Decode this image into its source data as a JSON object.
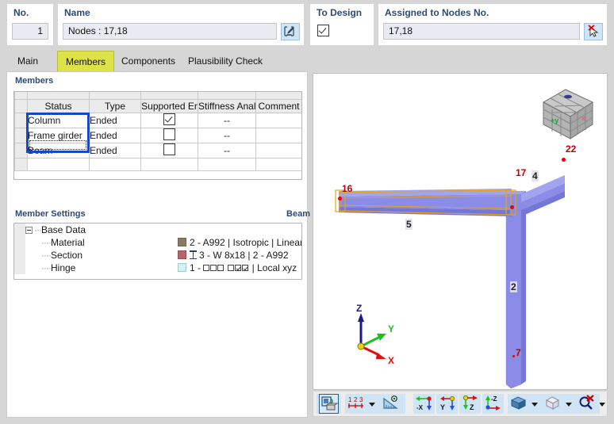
{
  "header": {
    "no_label": "No.",
    "no_value": "1",
    "name_label": "Name",
    "name_value": "Nodes : 17,18",
    "name_edit_icon": "edit-pencil-icon",
    "design_label": "To Design",
    "design_checked": true,
    "nodes_label": "Assigned to Nodes No.",
    "nodes_value": "17,18",
    "nodes_pick_icon": "pick-cursor-delete-icon"
  },
  "tabs": [
    {
      "label": "Main",
      "active": false
    },
    {
      "label": "Members",
      "active": true
    },
    {
      "label": "Components",
      "active": false
    },
    {
      "label": "Plausibility Check",
      "active": false
    }
  ],
  "members_group": {
    "title": "Members",
    "columns": [
      "Status",
      "Type",
      "Supported Er",
      "Stiffness Anal",
      "Comment"
    ],
    "rows": [
      {
        "status": "Column",
        "type": "Ended",
        "supported": true,
        "stiffness": "--",
        "comment": ""
      },
      {
        "status": "Frame girder",
        "type": "Ended",
        "supported": false,
        "stiffness": "--",
        "comment": ""
      },
      {
        "status": "Beam",
        "type": "Ended",
        "supported": false,
        "stiffness": "--",
        "comment": ""
      }
    ]
  },
  "member_settings": {
    "title": "Member Settings",
    "context": "Beam",
    "root": "Base Data",
    "entries": [
      {
        "label": "Material",
        "value": "2 - A992 | Isotropic | Linear ...",
        "swatch": "#8a7a63",
        "glyph": "swatch"
      },
      {
        "label": "Section",
        "value": "3 - W 8x18 | 2 - A992",
        "swatch": "#b4666a",
        "glyph": "ibeam"
      },
      {
        "label": "Hinge",
        "value_prefix": "1 - ",
        "value_suffix": " | Local xyz",
        "swatch": "#ccf3f5",
        "glyph": "hinge",
        "hinge_boxes": [
          false,
          false,
          false,
          false,
          true,
          true
        ]
      }
    ]
  },
  "view": {
    "nav_cube_label_y": "+y",
    "nav_cube_label_x": "x",
    "node_labels": [
      "16",
      "17",
      "22",
      "7"
    ],
    "member_labels": [
      "5",
      "4",
      "2"
    ],
    "axes": {
      "z": "Z",
      "y": "Y",
      "x": "X"
    },
    "toolbar": [
      {
        "name": "render-mode-button",
        "icon": "render-mode-icon"
      },
      {
        "name": "numbering-button",
        "icon": "numbering-123-icon",
        "has_caret": true
      },
      {
        "name": "measure-button",
        "icon": "measure-ruler-icon"
      },
      {
        "name": "view-minus-x-button",
        "icon": "view-minus-x-icon",
        "label": "-X"
      },
      {
        "name": "view-y-button",
        "icon": "view-y-icon",
        "label": "Y"
      },
      {
        "name": "view-z-button",
        "icon": "view-z-icon",
        "label": "Z"
      },
      {
        "name": "view-minus-z-button",
        "icon": "view-minus-z-icon",
        "label": "-Z"
      },
      {
        "name": "solid-view-button",
        "icon": "solid-box-icon",
        "has_caret": true
      },
      {
        "name": "wireframe-view-button",
        "icon": "wireframe-box-icon",
        "has_caret": true
      },
      {
        "name": "print-button",
        "icon": "printer-icon",
        "has_caret": true
      },
      {
        "name": "zoom-reset-button",
        "icon": "zoom-delete-icon"
      }
    ]
  },
  "colors": {
    "accent_tab": "#dde246",
    "selection_blue": "#1547c8",
    "label_blue": "#2e4a73",
    "node_red": "#c00000",
    "member_blue": "#8a8ce8"
  }
}
